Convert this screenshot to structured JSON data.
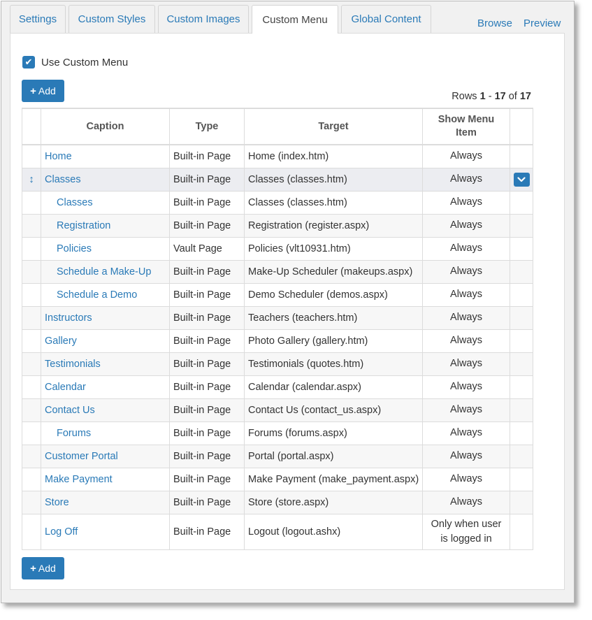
{
  "tabs": [
    {
      "label": "Settings",
      "active": false
    },
    {
      "label": "Custom Styles",
      "active": false
    },
    {
      "label": "Custom Images",
      "active": false
    },
    {
      "label": "Custom Menu",
      "active": true
    },
    {
      "label": "Global Content",
      "active": false
    }
  ],
  "links": {
    "browse": "Browse",
    "preview": "Preview"
  },
  "use_custom_menu": {
    "label": "Use Custom Menu",
    "checked": true
  },
  "add_button_label": "Add",
  "rows_info": {
    "prefix": "Rows",
    "from": "1",
    "sep": "-",
    "to": "17",
    "of_label": "of",
    "total": "17"
  },
  "table": {
    "headers": {
      "caption": "Caption",
      "type": "Type",
      "target": "Target",
      "show": "Show Menu Item"
    },
    "rows": [
      {
        "caption": "Home",
        "type": "Built-in Page",
        "target": "Home (index.htm)",
        "show": "Always",
        "child": false
      },
      {
        "caption": "Classes",
        "type": "Built-in Page",
        "target": "Classes (classes.htm)",
        "show": "Always",
        "child": false,
        "active": true
      },
      {
        "caption": "Classes",
        "type": "Built-in Page",
        "target": "Classes (classes.htm)",
        "show": "Always",
        "child": true
      },
      {
        "caption": "Registration",
        "type": "Built-in Page",
        "target": "Registration (register.aspx)",
        "show": "Always",
        "child": true
      },
      {
        "caption": "Policies",
        "type": "Vault Page",
        "target": "Policies (vlt10931.htm)",
        "show": "Always",
        "child": true
      },
      {
        "caption": "Schedule a Make-Up",
        "type": "Built-in Page",
        "target": "Make-Up Scheduler (makeups.aspx)",
        "show": "Always",
        "child": true
      },
      {
        "caption": "Schedule a Demo",
        "type": "Built-in Page",
        "target": "Demo Scheduler (demos.aspx)",
        "show": "Always",
        "child": true
      },
      {
        "caption": "Instructors",
        "type": "Built-in Page",
        "target": "Teachers (teachers.htm)",
        "show": "Always",
        "child": false
      },
      {
        "caption": "Gallery",
        "type": "Built-in Page",
        "target": "Photo Gallery (gallery.htm)",
        "show": "Always",
        "child": false
      },
      {
        "caption": "Testimonials",
        "type": "Built-in Page",
        "target": "Testimonials (quotes.htm)",
        "show": "Always",
        "child": false
      },
      {
        "caption": "Calendar",
        "type": "Built-in Page",
        "target": "Calendar (calendar.aspx)",
        "show": "Always",
        "child": false
      },
      {
        "caption": "Contact Us",
        "type": "Built-in Page",
        "target": "Contact Us (contact_us.aspx)",
        "show": "Always",
        "child": false
      },
      {
        "caption": "Forums",
        "type": "Built-in Page",
        "target": "Forums (forums.aspx)",
        "show": "Always",
        "child": true
      },
      {
        "caption": "Customer Portal",
        "type": "Built-in Page",
        "target": "Portal (portal.aspx)",
        "show": "Always",
        "child": false
      },
      {
        "caption": "Make Payment",
        "type": "Built-in Page",
        "target": "Make Payment (make_payment.aspx)",
        "show": "Always",
        "child": false
      },
      {
        "caption": "Store",
        "type": "Built-in Page",
        "target": "Store (store.aspx)",
        "show": "Always",
        "child": false
      },
      {
        "caption": "Log Off",
        "type": "Built-in Page",
        "target": "Logout (logout.ashx)",
        "show": "Only when user is logged in",
        "child": false
      }
    ]
  },
  "colors": {
    "accent": "#2a7ab7",
    "frame_bg": "#f1f1f1",
    "active_row": "#ecedf1"
  },
  "icons": {
    "checkbox": "check-icon",
    "add": "plus-icon",
    "drag": "drag-handle-icon",
    "row_menu": "chevron-down-icon"
  }
}
